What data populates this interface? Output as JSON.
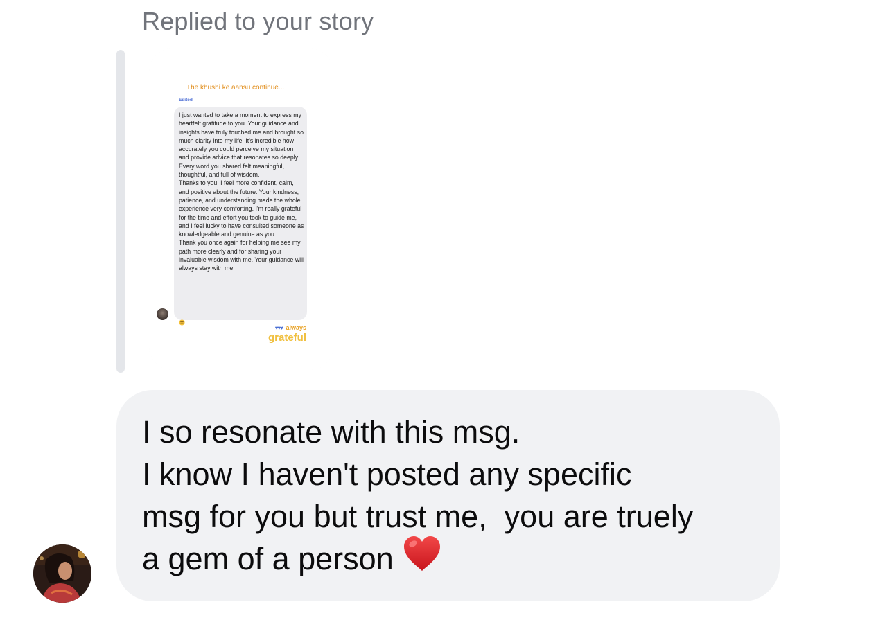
{
  "header": {
    "reply_label": "Replied to your story"
  },
  "story": {
    "title": "The khushi ke aansu continue...",
    "edited_label": "Edited",
    "message": "I just wanted to take a moment to express my heartfelt gratitude to you. Your guidance and insights have truly touched me and brought so much clarity into my life. It's incredible how accurately you could perceive my situation and provide advice that resonates so deeply. Every word you shared felt meaningful, thoughtful, and full of wisdom.\nThanks to you, I feel more confident, calm, and positive about the future. Your kindness, patience, and understanding made the whole experience very comforting. I'm really grateful for the time and effort you took to guide me, and I feel lucky to have consulted someone as knowledgeable and genuine as you.\nThank you once again for helping me see my path more clearly and for sharing your invaluable wisdom with me. Your guidance will always stay with me.",
    "sticker_top": "always",
    "sticker_main": "grateful",
    "reaction_emoji": "smiling-face-with-tear"
  },
  "message": {
    "lines": [
      "I so resonate with this msg.",
      "I know I haven't posted any specific",
      "msg for you but trust me,  you are truely",
      "a gem of a person"
    ],
    "trailing_emoji": "red-heart"
  },
  "colors": {
    "bubble_bg": "#f1f2f4",
    "label_gray": "#71747b",
    "heart_red": "#e0242b",
    "story_title_orange": "#e08a14"
  }
}
